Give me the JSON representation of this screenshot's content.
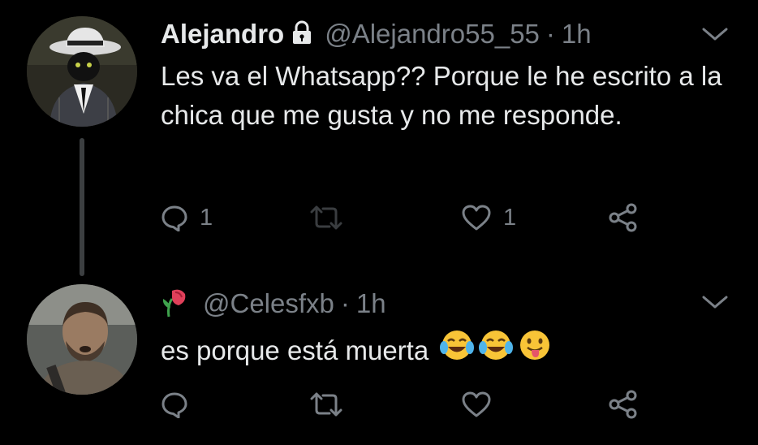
{
  "tweets": [
    {
      "display_name": "Alejandro",
      "handle": "@Alejandro55_55",
      "separator": "·",
      "time": "1h",
      "text": "Les va el Whatsapp?? Porque le he escrito a la chica que me gusta y no me responde.",
      "reply_count": "1",
      "retweet_count": "",
      "like_count": "1",
      "locked": true,
      "avatar": "cat-in-suit-avatar"
    },
    {
      "display_name": "",
      "handle": "@Celesfxb",
      "separator": "·",
      "time": "1h",
      "text": "es porque está muerta",
      "emojis": [
        "face-with-tears-of-joy",
        "face-with-tears-of-joy",
        "face-with-tongue"
      ],
      "reply_count": "",
      "retweet_count": "",
      "like_count": "",
      "avatar": "bearded-man-avatar"
    }
  ],
  "colors": {
    "background": "#000000",
    "text": "#e7e9ea",
    "secondary": "#7b8188",
    "thread_line": "#3c3f41"
  }
}
